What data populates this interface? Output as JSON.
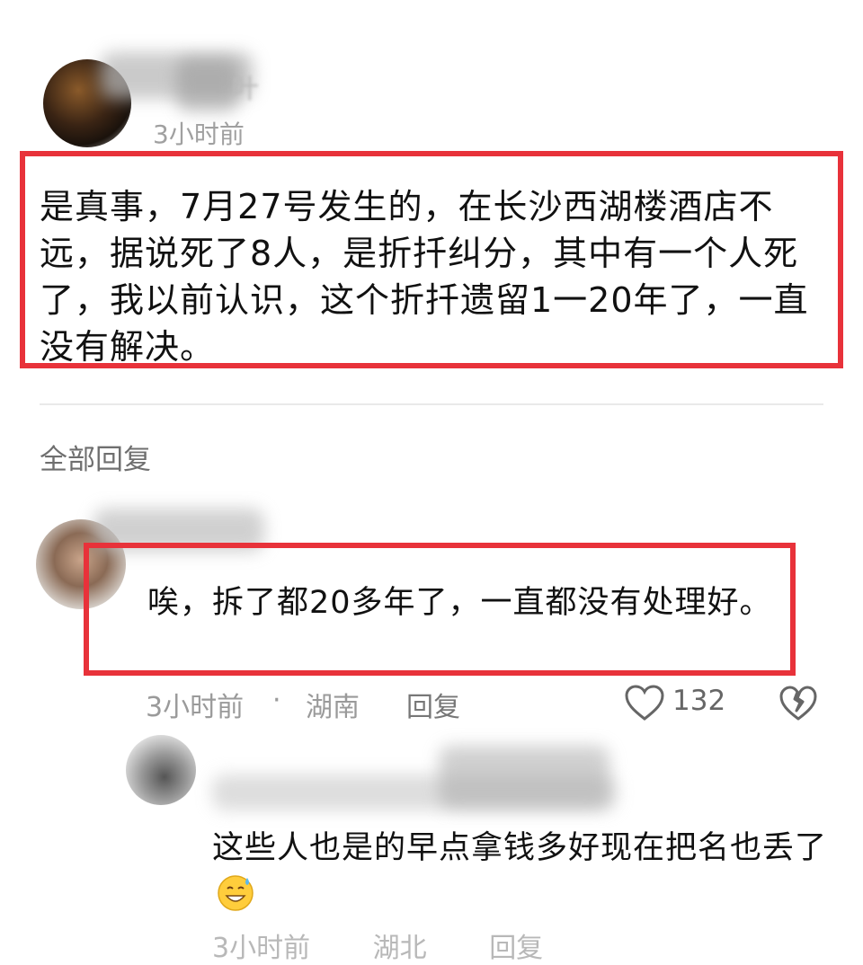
{
  "comment": {
    "username_visible": "叶",
    "time": "3小时前",
    "text": "是真事，7月27号发生的，在长沙西湖楼酒店不远，据说死了8人，是折扦纠分，其中有一个人死了，我以前认识，这个折扦遗留1一20年了，一直没有解决。"
  },
  "replies_header": "全部回复",
  "reply": {
    "text": "唉，拆了都20多年了，一直都没有处理好。",
    "time": "3小时前",
    "separator": "·",
    "location": "湖南",
    "reply_label": "回复",
    "likes": "132"
  },
  "subreply": {
    "text": "这些人也是的早点拿钱多好现在把名也丢了",
    "emoji": "grinning-sweat-emoji",
    "time_partial": "3小时前",
    "location_partial": "湖北",
    "reply_partial": "回复"
  },
  "colors": {
    "highlight_border": "#e8323a",
    "meta_text": "#9a9a9a",
    "divider": "#e9e9e9"
  }
}
